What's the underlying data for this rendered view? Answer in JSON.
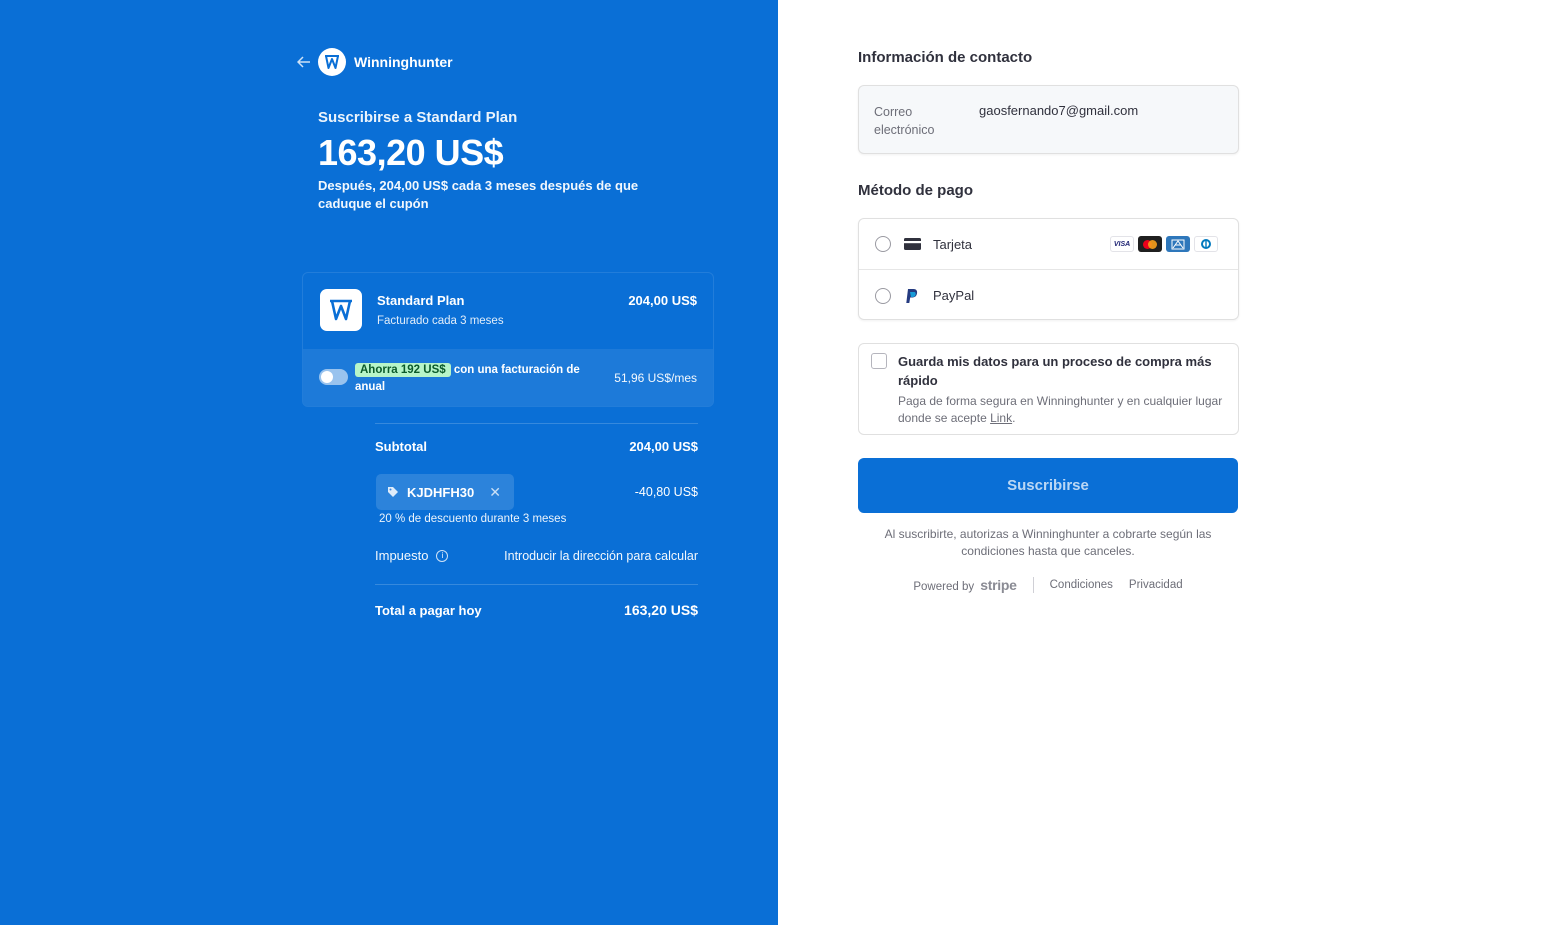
{
  "colors": {
    "primary": "#0a6fd6",
    "badge_bg": "#b7f5c8",
    "badge_text": "#0b5a2a"
  },
  "merchant": {
    "name": "Winninghunter"
  },
  "header": {
    "subscribe_title": "Suscribirse a Standard Plan",
    "price": "163,20 US$",
    "after_text": "Después, 204,00 US$ cada 3 meses después de que caduque el cupón"
  },
  "plan": {
    "name": "Standard Plan",
    "billed": "Facturado cada 3 meses",
    "price": "204,00 US$",
    "savings_badge": "Ahorra 192 US$",
    "savings_text": "con una facturación de anual",
    "monthly_price": "51,96 US$/mes"
  },
  "summary": {
    "subtotal_label": "Subtotal",
    "subtotal_value": "204,00 US$",
    "coupon_code": "KJDHFH30",
    "coupon_discount": "-40,80 US$",
    "coupon_desc": "20 % de descuento durante 3 meses",
    "tax_label": "Impuesto",
    "tax_value": "Introducir la dirección para calcular",
    "total_label": "Total a pagar hoy",
    "total_value": "163,20 US$"
  },
  "contact": {
    "title": "Información de contacto",
    "email_label": "Correo electrónico",
    "email_value": "gaosfernando7@gmail.com"
  },
  "payment": {
    "title": "Método de pago",
    "card_label": "Tarjeta",
    "paypal_label": "PayPal",
    "brands": [
      "visa",
      "mastercard",
      "amex",
      "diners"
    ]
  },
  "save": {
    "title": "Guarda mis datos para un proceso de compra más rápido",
    "desc": "Paga de forma segura en Winninghunter y en cualquier lugar donde se acepte",
    "link": "Link",
    "period": "."
  },
  "button": {
    "subscribe": "Suscribirse"
  },
  "legal": "Al suscribirte, autorizas a Winninghunter a cobrarte según las condiciones hasta que canceles.",
  "footer": {
    "powered": "Powered by",
    "stripe": "stripe",
    "terms": "Condiciones",
    "privacy": "Privacidad"
  }
}
